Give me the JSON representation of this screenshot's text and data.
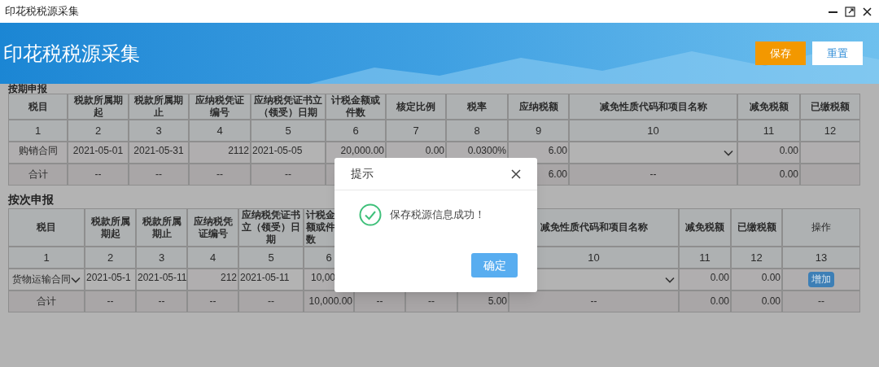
{
  "window": {
    "title": "印花税税源采集"
  },
  "header": {
    "title": "印花税税源采集",
    "buttons": [
      {
        "label": "保存",
        "kind": "primary"
      },
      {
        "label": "重置",
        "kind": "secondary"
      }
    ]
  },
  "sections": [
    {
      "title": "按期申报",
      "columns": [
        "税目",
        "税款所属期起",
        "税款所属期止",
        "应纳税凭证编号",
        "应纳税凭证书立（领受）日期",
        "计税金额或件数",
        "核定比例",
        "税率",
        "应纳税额",
        "减免性质代码和项目名称",
        "减免税额",
        "已缴税额"
      ],
      "index_row": [
        {
          "text": "1"
        },
        {
          "text": "2"
        },
        {
          "text": "3"
        },
        {
          "text": "4"
        },
        {
          "text": "5"
        },
        {
          "text": "6"
        },
        {
          "text": "7"
        },
        {
          "text": "8"
        },
        {
          "text": "9"
        },
        {
          "text": "10"
        },
        {
          "text": "11"
        },
        {
          "text": "12"
        }
      ],
      "rows": [
        {
          "kind": "data",
          "cells": [
            {
              "kind": "text",
              "text": "购销合同"
            },
            {
              "kind": "text",
              "text": "2021-05-01"
            },
            {
              "kind": "text",
              "text": "2021-05-31"
            },
            {
              "kind": "number",
              "text": "2112"
            },
            {
              "kind": "date",
              "text": "2021-05-05"
            },
            {
              "kind": "number",
              "text": "20,000.00"
            },
            {
              "kind": "number",
              "text": "0.00"
            },
            {
              "kind": "number",
              "text": "0.0300%"
            },
            {
              "kind": "number",
              "text": "6.00"
            },
            {
              "kind": "select"
            },
            {
              "kind": "number",
              "text": "0.00"
            },
            null
          ]
        },
        {
          "kind": "total",
          "cells": [
            {
              "kind": "text",
              "text": "合计"
            },
            {
              "kind": "text",
              "text": "--"
            },
            {
              "kind": "text",
              "text": "--"
            },
            {
              "kind": "text",
              "text": "--"
            },
            {
              "kind": "text",
              "text": "--"
            },
            null,
            null,
            null,
            {
              "kind": "number",
              "text": "6.00"
            },
            {
              "kind": "text",
              "text": "--"
            },
            {
              "kind": "number",
              "text": "0.00"
            },
            null
          ]
        }
      ]
    },
    {
      "title": "按次申报",
      "columns": [
        "税目",
        "税款所属期起",
        "税款所属期止",
        "应纳税凭证编号",
        "应纳税凭证书立（领受）日期",
        "计税金额或件数",
        null,
        null,
        null,
        "减免性质代码和项目名称",
        "减免税额",
        "已缴税额",
        "操作"
      ],
      "index_row": [
        {
          "text": "1"
        },
        {
          "text": "2"
        },
        {
          "text": "3"
        },
        {
          "text": "4"
        },
        {
          "text": "5"
        },
        {
          "text": "6"
        }
      ],
      "index_row_after_gap": [
        {
          "text": "10"
        },
        {
          "text": "11"
        },
        {
          "text": "12"
        },
        {
          "text": "13"
        }
      ],
      "rows": [
        {
          "kind": "data",
          "cells": [
            {
              "kind": "select",
              "text": "货物运输合同"
            },
            {
              "kind": "date",
              "text": "2021-05-1"
            },
            {
              "kind": "date",
              "text": "2021-05-11"
            },
            {
              "kind": "number",
              "text": "212"
            },
            {
              "kind": "date",
              "text": "2021-05-11"
            },
            {
              "kind": "number",
              "text": "10,00"
            },
            null,
            null,
            null,
            {
              "kind": "select"
            },
            {
              "kind": "number",
              "text": "0.00"
            },
            {
              "kind": "number",
              "text": "0.00"
            },
            {
              "kind": "button",
              "text": "增加"
            }
          ]
        },
        {
          "kind": "total",
          "cells": [
            {
              "kind": "text",
              "text": "合计"
            },
            {
              "kind": "text",
              "text": "--"
            },
            {
              "kind": "text",
              "text": "--"
            },
            {
              "kind": "text",
              "text": "--"
            },
            {
              "kind": "text",
              "text": "--"
            },
            {
              "kind": "number",
              "text": "10,000.00"
            },
            {
              "kind": "text",
              "text": "--"
            },
            {
              "kind": "text",
              "text": "--"
            },
            {
              "kind": "number",
              "text": "5.00"
            },
            {
              "kind": "text",
              "text": "--"
            },
            {
              "kind": "number",
              "text": "0.00"
            },
            {
              "kind": "number",
              "text": "0.00"
            },
            {
              "kind": "text",
              "text": "--"
            }
          ]
        }
      ]
    }
  ],
  "dialog": {
    "title": "提示",
    "message": "保存税源信息成功！",
    "button": "确定"
  }
}
